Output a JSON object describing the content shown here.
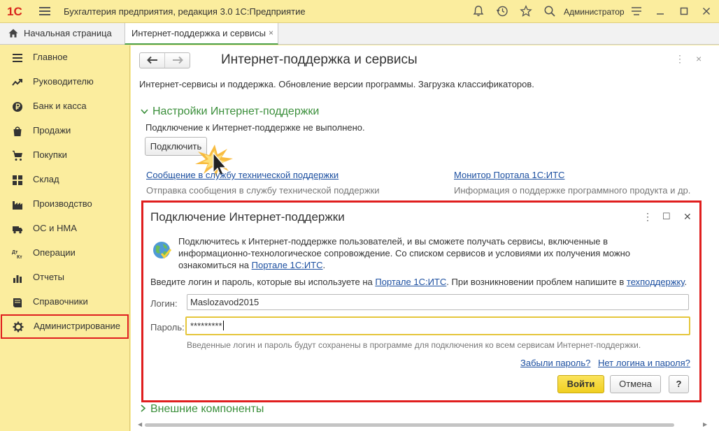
{
  "titlebar": {
    "logo": "1С",
    "title": "Бухгалтерия предприятия, редакция 3.0 1С:Предприятие",
    "user": "Администратор",
    "icons": [
      "menu-icon",
      "bell-icon",
      "history-icon",
      "star-icon",
      "search-icon",
      "settings-icon",
      "minimize-icon",
      "maximize-icon",
      "close-icon"
    ]
  },
  "tabs": {
    "home": "Начальная страница",
    "active": "Интернет-поддержка и сервисы",
    "close": "×"
  },
  "sidebar": {
    "items": [
      {
        "label": "Главное",
        "icon": "menu-icon"
      },
      {
        "label": "Руководителю",
        "icon": "trend-icon"
      },
      {
        "label": "Банк и касса",
        "icon": "ruble-icon"
      },
      {
        "label": "Продажи",
        "icon": "bag-icon"
      },
      {
        "label": "Покупки",
        "icon": "cart-icon"
      },
      {
        "label": "Склад",
        "icon": "warehouse-icon"
      },
      {
        "label": "Производство",
        "icon": "factory-icon"
      },
      {
        "label": "ОС и НМА",
        "icon": "truck-icon"
      },
      {
        "label": "Операции",
        "icon": "debit-credit-icon"
      },
      {
        "label": "Отчеты",
        "icon": "report-icon"
      },
      {
        "label": "Справочники",
        "icon": "book-icon"
      },
      {
        "label": "Администрирование",
        "icon": "gear-icon"
      }
    ],
    "selected_index": 11
  },
  "main": {
    "nav_back": "🡐",
    "nav_forward": "🡒",
    "title": "Интернет-поддержка и сервисы",
    "more": "⋮",
    "close": "×",
    "subtitle": "Интернет-сервисы и поддержка. Обновление версии программы. Загрузка классификаторов.",
    "section1": {
      "title": "Настройки Интернет-поддержки",
      "status": "Подключение к Интернет-поддержке не выполнено.",
      "connect_button": "Подключить"
    },
    "links": {
      "support_message": "Сообщение в службу технической поддержки",
      "support_message_hint": "Отправка сообщения в службу технической поддержки",
      "portal_monitor": "Монитор Портала 1С:ИТС",
      "portal_monitor_hint": "Информация о поддержке программного продукта и др."
    },
    "section2": {
      "title": "Внешние компоненты"
    }
  },
  "dialog": {
    "title": "Подключение Интернет-поддержки",
    "more": "⋮",
    "maximize": "☐",
    "close": "✕",
    "info_line1": "Подключитесь к Интернет-поддержке пользователей, и вы сможете получать сервисы, включенные в",
    "info_line2": "информационно-технологическое сопровождение. Со списком сервисов и условиями их получения можно",
    "info_line3_prefix": "ознакомиться на ",
    "info_line3_link": "Портале 1С:ИТС",
    "info_line3_suffix": ".",
    "enter_prefix": "Введите логин и пароль, которые вы используете на ",
    "enter_link1": "Портале 1С:ИТС",
    "enter_middle": ". При возникновении проблем напишите в ",
    "enter_link2": "техподдержку",
    "enter_suffix": ".",
    "login_label": "Логин:",
    "login_value": "Maslozavod2015",
    "password_label": "Пароль:",
    "password_value": "*********",
    "note": "Введенные логин и пароль будут сохранены в программе для подключения ко всем сервисам Интернет-поддержки.",
    "forgot_password": "Забыли пароль?",
    "no_login": "Нет логина и пароля?",
    "ok_button": "Войти",
    "cancel_button": "Отмена",
    "help_button": "?"
  }
}
